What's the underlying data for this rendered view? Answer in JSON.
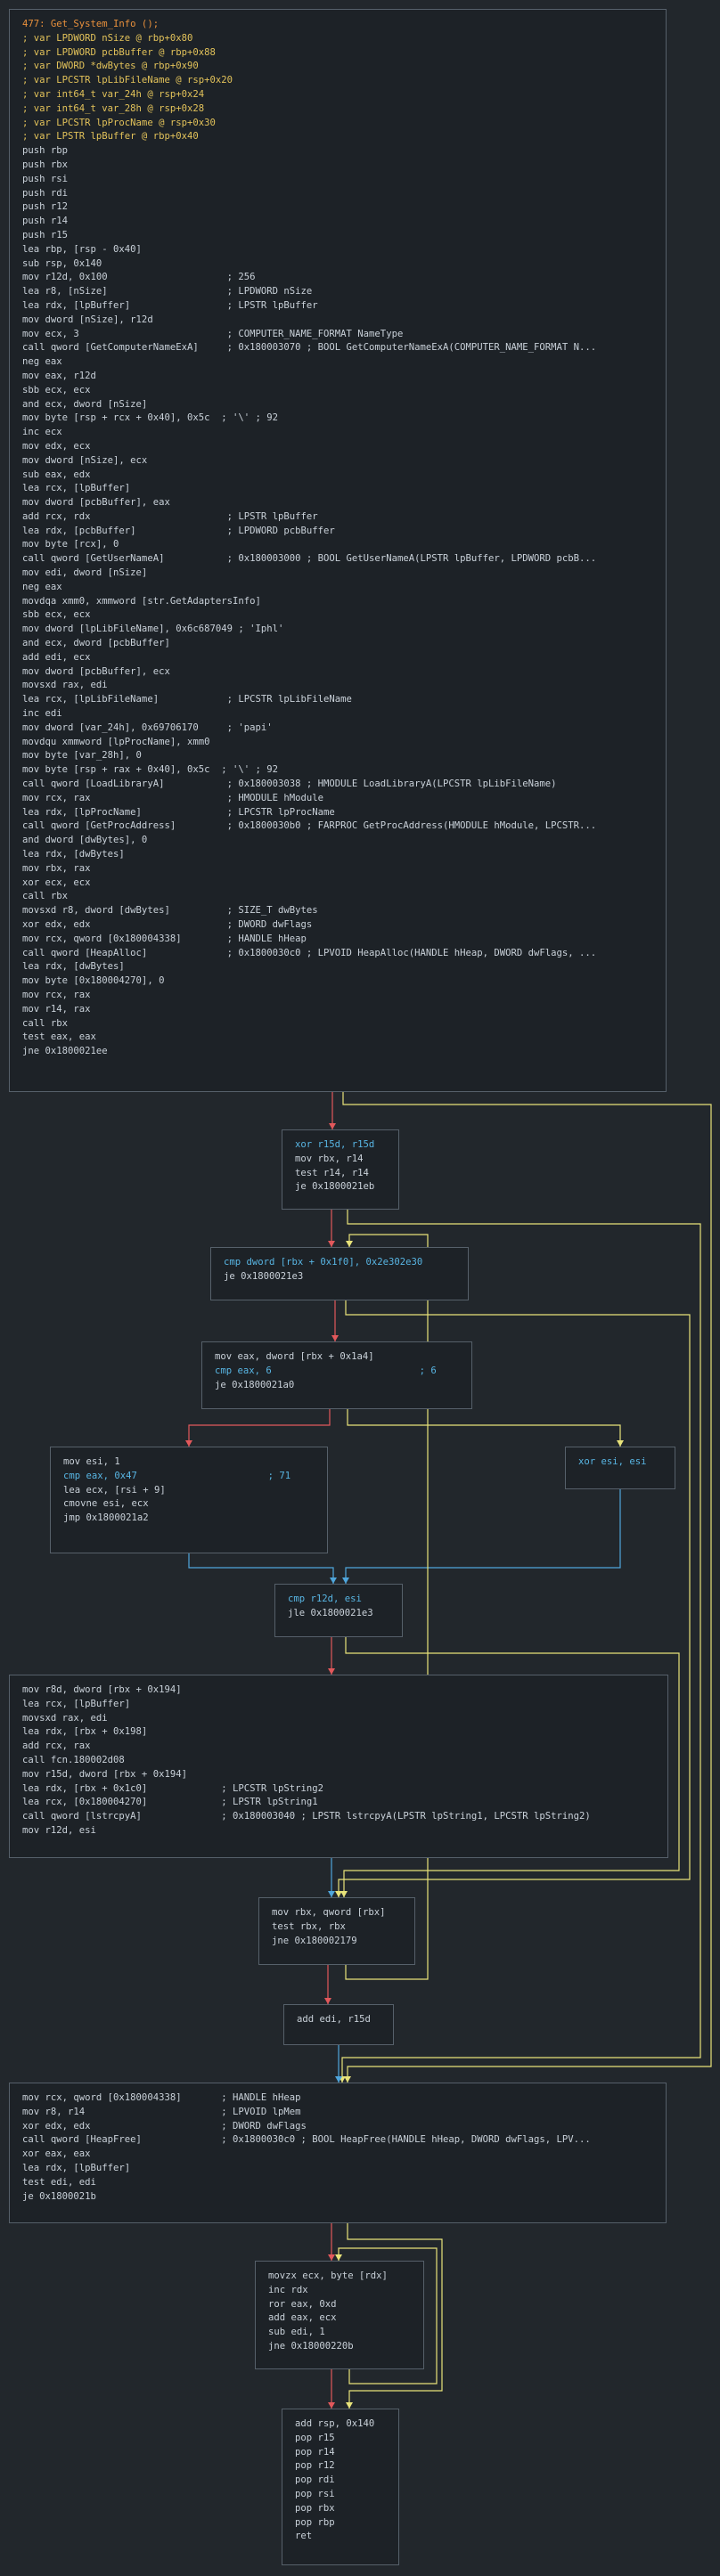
{
  "colors": {
    "background": "#22272c",
    "block_background": "#1d2227",
    "block_border": "#56606a",
    "edge_true": "#e8e37a",
    "edge_false": "#e2585b",
    "edge_unconditional": "#4fa6dc"
  },
  "blocks": [
    {
      "id": "b0",
      "lines": [
        {
          "t": "477: Get_System_Info ();",
          "c": "orange"
        },
        {
          "t": "; var LPDWORD nSize @ rbp+0x80",
          "c": "yellow"
        },
        {
          "t": "; var LPDWORD pcbBuffer @ rbp+0x88",
          "c": "yellow"
        },
        {
          "t": "; var DWORD *dwBytes @ rbp+0x90",
          "c": "yellow"
        },
        {
          "t": "; var LPCSTR lpLibFileName @ rsp+0x20",
          "c": "yellow"
        },
        {
          "t": "; var int64_t var_24h @ rsp+0x24",
          "c": "yellow"
        },
        {
          "t": "; var int64_t var_28h @ rsp+0x28",
          "c": "yellow"
        },
        {
          "t": "; var LPCSTR lpProcName @ rsp+0x30",
          "c": "yellow"
        },
        {
          "t": "; var LPSTR lpBuffer @ rbp+0x40",
          "c": "yellow"
        },
        {
          "t": "push rbp",
          "c": "gray"
        },
        {
          "t": "push rbx",
          "c": "gray"
        },
        {
          "t": "push rsi",
          "c": "gray"
        },
        {
          "t": "push rdi",
          "c": "gray"
        },
        {
          "t": "push r12",
          "c": "gray"
        },
        {
          "t": "push r14",
          "c": "gray"
        },
        {
          "t": "push r15",
          "c": "gray"
        },
        {
          "t": "lea rbp, [rsp - 0x40]",
          "c": "gray"
        },
        {
          "t": "sub rsp, 0x140",
          "c": "gray"
        },
        {
          "t": "mov r12d, 0x100                     ; 256",
          "c": "gray"
        },
        {
          "t": "lea r8, [nSize]                     ; LPDWORD nSize",
          "c": "gray"
        },
        {
          "t": "lea rdx, [lpBuffer]                 ; LPSTR lpBuffer",
          "c": "gray"
        },
        {
          "t": "mov dword [nSize], r12d",
          "c": "gray"
        },
        {
          "t": "mov ecx, 3                          ; COMPUTER_NAME_FORMAT NameType",
          "c": "gray"
        },
        {
          "t": "call qword [GetComputerNameExA]     ; 0x180003070 ; BOOL GetComputerNameExA(COMPUTER_NAME_FORMAT N...",
          "c": "gray"
        },
        {
          "t": "neg eax",
          "c": "gray"
        },
        {
          "t": "mov eax, r12d",
          "c": "gray"
        },
        {
          "t": "sbb ecx, ecx",
          "c": "gray"
        },
        {
          "t": "and ecx, dword [nSize]",
          "c": "gray"
        },
        {
          "t": "mov byte [rsp + rcx + 0x40], 0x5c  ; '\\' ; 92",
          "c": "gray"
        },
        {
          "t": "inc ecx",
          "c": "gray"
        },
        {
          "t": "mov edx, ecx",
          "c": "gray"
        },
        {
          "t": "mov dword [nSize], ecx",
          "c": "gray"
        },
        {
          "t": "sub eax, edx",
          "c": "gray"
        },
        {
          "t": "lea rcx, [lpBuffer]",
          "c": "gray"
        },
        {
          "t": "mov dword [pcbBuffer], eax",
          "c": "gray"
        },
        {
          "t": "add rcx, rdx                        ; LPSTR lpBuffer",
          "c": "gray"
        },
        {
          "t": "lea rdx, [pcbBuffer]                ; LPDWORD pcbBuffer",
          "c": "gray"
        },
        {
          "t": "mov byte [rcx], 0",
          "c": "gray"
        },
        {
          "t": "call qword [GetUserNameA]           ; 0x180003000 ; BOOL GetUserNameA(LPSTR lpBuffer, LPDWORD pcbB...",
          "c": "gray"
        },
        {
          "t": "mov edi, dword [nSize]",
          "c": "gray"
        },
        {
          "t": "neg eax",
          "c": "gray"
        },
        {
          "t": "movdqa xmm0, xmmword [str.GetAdaptersInfo]",
          "c": "gray"
        },
        {
          "t": "sbb ecx, ecx",
          "c": "gray"
        },
        {
          "t": "mov dword [lpLibFileName], 0x6c687049 ; 'Iphl'",
          "c": "gray"
        },
        {
          "t": "and ecx, dword [pcbBuffer]",
          "c": "gray"
        },
        {
          "t": "add edi, ecx",
          "c": "gray"
        },
        {
          "t": "mov dword [pcbBuffer], ecx",
          "c": "gray"
        },
        {
          "t": "movsxd rax, edi",
          "c": "gray"
        },
        {
          "t": "lea rcx, [lpLibFileName]            ; LPCSTR lpLibFileName",
          "c": "gray"
        },
        {
          "t": "inc edi",
          "c": "gray"
        },
        {
          "t": "mov dword [var_24h], 0x69706170     ; 'papi'",
          "c": "gray"
        },
        {
          "t": "movdqu xmmword [lpProcName], xmm0",
          "c": "gray"
        },
        {
          "t": "mov byte [var_28h], 0",
          "c": "gray"
        },
        {
          "t": "mov byte [rsp + rax + 0x40], 0x5c  ; '\\' ; 92",
          "c": "gray"
        },
        {
          "t": "call qword [LoadLibraryA]           ; 0x180003038 ; HMODULE LoadLibraryA(LPCSTR lpLibFileName)",
          "c": "gray"
        },
        {
          "t": "mov rcx, rax                        ; HMODULE hModule",
          "c": "gray"
        },
        {
          "t": "lea rdx, [lpProcName]               ; LPCSTR lpProcName",
          "c": "gray"
        },
        {
          "t": "call qword [GetProcAddress]         ; 0x1800030b0 ; FARPROC GetProcAddress(HMODULE hModule, LPCSTR...",
          "c": "gray"
        },
        {
          "t": "and dword [dwBytes], 0",
          "c": "gray"
        },
        {
          "t": "lea rdx, [dwBytes]",
          "c": "gray"
        },
        {
          "t": "mov rbx, rax",
          "c": "gray"
        },
        {
          "t": "xor ecx, ecx",
          "c": "gray"
        },
        {
          "t": "call rbx",
          "c": "gray"
        },
        {
          "t": "movsxd r8, dword [dwBytes]          ; SIZE_T dwBytes",
          "c": "gray"
        },
        {
          "t": "xor edx, edx                        ; DWORD dwFlags",
          "c": "gray"
        },
        {
          "t": "mov rcx, qword [0x180004338]        ; HANDLE hHeap",
          "c": "gray"
        },
        {
          "t": "call qword [HeapAlloc]              ; 0x1800030c0 ; LPVOID HeapAlloc(HANDLE hHeap, DWORD dwFlags, ...",
          "c": "gray"
        },
        {
          "t": "lea rdx, [dwBytes]",
          "c": "gray"
        },
        {
          "t": "mov byte [0x180004270], 0",
          "c": "gray"
        },
        {
          "t": "mov rcx, rax",
          "c": "gray"
        },
        {
          "t": "mov r14, rax",
          "c": "gray"
        },
        {
          "t": "call rbx",
          "c": "gray"
        },
        {
          "t": "test eax, eax",
          "c": "gray"
        },
        {
          "t": "jne 0x1800021ee",
          "c": "gray"
        }
      ]
    },
    {
      "id": "b1",
      "lines": [
        {
          "t": "xor r15d, r15d",
          "c": "blue"
        },
        {
          "t": "mov rbx, r14",
          "c": "gray"
        },
        {
          "t": "test r14, r14",
          "c": "gray"
        },
        {
          "t": "je 0x1800021eb",
          "c": "gray"
        }
      ]
    },
    {
      "id": "b2",
      "lines": [
        {
          "t": "cmp dword [rbx + 0x1f0], 0x2e302e30",
          "c": "blue"
        },
        {
          "t": "je 0x1800021e3",
          "c": "gray"
        }
      ]
    },
    {
      "id": "b3",
      "lines": [
        {
          "t": "mov eax, dword [rbx + 0x1a4]",
          "c": "gray"
        },
        {
          "t": "cmp eax, 6                          ; 6",
          "c": "blue"
        },
        {
          "t": "je 0x1800021a0",
          "c": "gray"
        }
      ]
    },
    {
      "id": "b4",
      "lines": [
        {
          "t": "mov esi, 1",
          "c": "gray"
        },
        {
          "t": "cmp eax, 0x47                       ; 71",
          "c": "blue"
        },
        {
          "t": "lea ecx, [rsi + 9]",
          "c": "gray"
        },
        {
          "t": "cmovne esi, ecx",
          "c": "gray"
        },
        {
          "t": "jmp 0x1800021a2",
          "c": "gray"
        }
      ]
    },
    {
      "id": "b5",
      "lines": [
        {
          "t": "xor esi, esi",
          "c": "blue"
        }
      ]
    },
    {
      "id": "b6",
      "lines": [
        {
          "t": "cmp r12d, esi",
          "c": "blue"
        },
        {
          "t": "jle 0x1800021e3",
          "c": "gray"
        }
      ]
    },
    {
      "id": "b7",
      "lines": [
        {
          "t": "mov r8d, dword [rbx + 0x194]",
          "c": "gray"
        },
        {
          "t": "lea rcx, [lpBuffer]",
          "c": "gray"
        },
        {
          "t": "movsxd rax, edi",
          "c": "gray"
        },
        {
          "t": "lea rdx, [rbx + 0x198]",
          "c": "gray"
        },
        {
          "t": "add rcx, rax",
          "c": "gray"
        },
        {
          "t": "call fcn.180002d08",
          "c": "gray"
        },
        {
          "t": "mov r15d, dword [rbx + 0x194]",
          "c": "gray"
        },
        {
          "t": "lea rdx, [rbx + 0x1c0]             ; LPCSTR lpString2",
          "c": "gray"
        },
        {
          "t": "lea rcx, [0x180004270]             ; LPSTR lpString1",
          "c": "gray"
        },
        {
          "t": "call qword [lstrcpyA]              ; 0x180003040 ; LPSTR lstrcpyA(LPSTR lpString1, LPCSTR lpString2)",
          "c": "gray"
        },
        {
          "t": "mov r12d, esi",
          "c": "gray"
        }
      ]
    },
    {
      "id": "b8",
      "lines": [
        {
          "t": "mov rbx, qword [rbx]",
          "c": "gray"
        },
        {
          "t": "test rbx, rbx",
          "c": "gray"
        },
        {
          "t": "jne 0x180002179",
          "c": "gray"
        }
      ]
    },
    {
      "id": "b9",
      "lines": [
        {
          "t": "add edi, r15d",
          "c": "gray"
        }
      ]
    },
    {
      "id": "b10",
      "lines": [
        {
          "t": "mov rcx, qword [0x180004338]       ; HANDLE hHeap",
          "c": "gray"
        },
        {
          "t": "mov r8, r14                        ; LPVOID lpMem",
          "c": "gray"
        },
        {
          "t": "xor edx, edx                       ; DWORD dwFlags",
          "c": "gray"
        },
        {
          "t": "call qword [HeapFree]              ; 0x1800030c0 ; BOOL HeapFree(HANDLE hHeap, DWORD dwFlags, LPV...",
          "c": "gray"
        },
        {
          "t": "xor eax, eax",
          "c": "gray"
        },
        {
          "t": "lea rdx, [lpBuffer]",
          "c": "gray"
        },
        {
          "t": "test edi, edi",
          "c": "gray"
        },
        {
          "t": "je 0x1800021b",
          "c": "gray"
        }
      ]
    },
    {
      "id": "b11",
      "lines": [
        {
          "t": "movzx ecx, byte [rdx]",
          "c": "gray"
        },
        {
          "t": "inc rdx",
          "c": "gray"
        },
        {
          "t": "ror eax, 0xd",
          "c": "gray"
        },
        {
          "t": "add eax, ecx",
          "c": "gray"
        },
        {
          "t": "sub edi, 1",
          "c": "gray"
        },
        {
          "t": "jne 0x18000220b",
          "c": "gray"
        }
      ]
    },
    {
      "id": "b12",
      "lines": [
        {
          "t": "add rsp, 0x140",
          "c": "gray"
        },
        {
          "t": "pop r15",
          "c": "gray"
        },
        {
          "t": "pop r14",
          "c": "gray"
        },
        {
          "t": "pop r12",
          "c": "gray"
        },
        {
          "t": "pop rdi",
          "c": "gray"
        },
        {
          "t": "pop rsi",
          "c": "gray"
        },
        {
          "t": "pop rbx",
          "c": "gray"
        },
        {
          "t": "pop rbp",
          "c": "gray"
        },
        {
          "t": "ret",
          "c": "gray"
        }
      ]
    }
  ]
}
